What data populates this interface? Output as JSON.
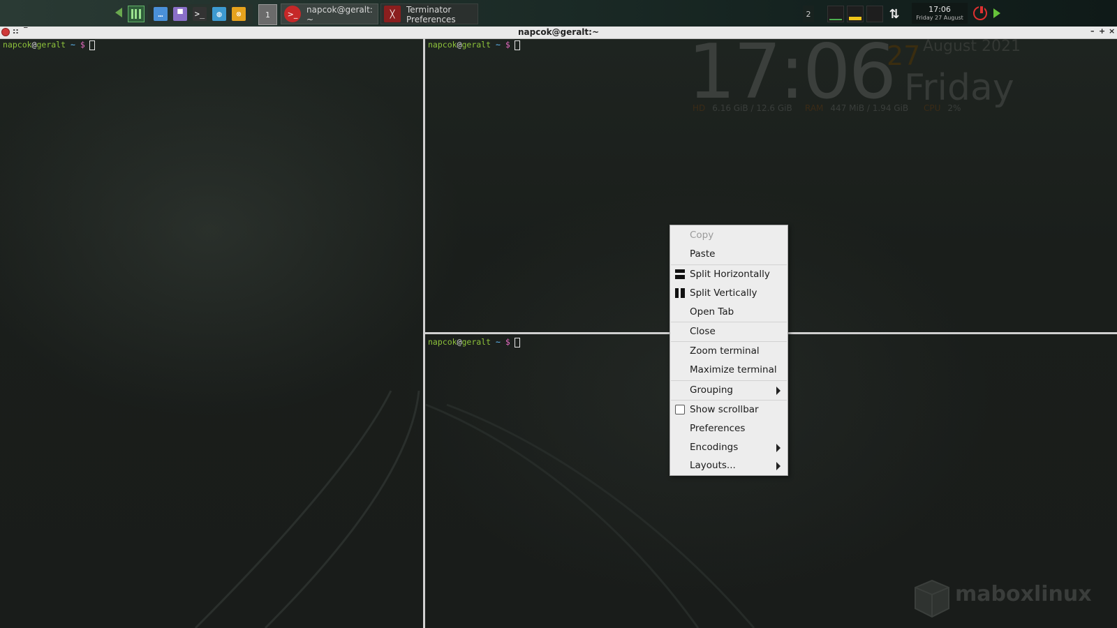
{
  "panel": {
    "workspace_left": "1",
    "tasks": [
      {
        "label": "napcok@geralt:\n~",
        "active": true,
        "icon": "terminal-red-icon"
      },
      {
        "label": "Terminator\nPreferences",
        "active": false,
        "icon": "terminator-icon"
      }
    ],
    "workspace_right": "2",
    "clock": {
      "time": "17:06",
      "date": "Friday 27 August"
    },
    "launchers": [
      "ellipsis-icon",
      "folder-icon",
      "terminal-icon",
      "browser-icon",
      "app-icon"
    ],
    "accent_color": "#64b36a",
    "power_color": "#e03030"
  },
  "window": {
    "title": "napcok@geralt:~"
  },
  "terminals": [
    {
      "user": "napcok",
      "at": "@",
      "host": "geralt",
      "path": "~",
      "symbol": "$"
    },
    {
      "user": "napcok",
      "at": "@",
      "host": "geralt",
      "path": "~",
      "symbol": "$"
    },
    {
      "user": "napcok",
      "at": "@",
      "host": "geralt",
      "path": "~",
      "symbol": "$"
    }
  ],
  "conky": {
    "time": "17:06",
    "day": "27",
    "month_year": "August 2021",
    "weekday": "Friday",
    "hd_label": "HD",
    "hd_value": "6.16 GiB / 12.6 GiB",
    "ram_label": "RAM",
    "ram_value": "447 MiB / 1.94 GiB",
    "cpu_label": "CPU",
    "cpu_value": "2%"
  },
  "context_menu": {
    "items": [
      {
        "label": "Copy",
        "disabled": true
      },
      {
        "label": "Paste"
      },
      {
        "label": "Split Horizontally",
        "icon": "split-horizontal-icon"
      },
      {
        "label": "Split Vertically",
        "icon": "split-vertical-icon"
      },
      {
        "label": "Open Tab"
      },
      {
        "label": "Close"
      },
      {
        "label": "Zoom terminal"
      },
      {
        "label": "Maximize terminal"
      },
      {
        "label": "Grouping",
        "submenu": true
      },
      {
        "label": "Show scrollbar",
        "checkbox": true,
        "checked": false
      },
      {
        "label": "Preferences"
      },
      {
        "label": "Encodings",
        "submenu": true
      },
      {
        "label": "Layouts...",
        "submenu": true
      }
    ]
  },
  "watermark": "maboxlinux"
}
